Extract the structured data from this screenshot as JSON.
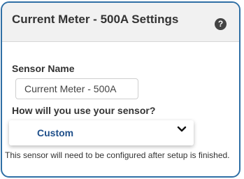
{
  "header": {
    "title": "Current Meter - 500A Settings",
    "help_icon": "question-icon",
    "help_glyph": "?"
  },
  "form": {
    "sensor_name_label": "Sensor Name",
    "sensor_name_value": "Current Meter - 500A",
    "usage_label": "How will you use your sensor?",
    "usage_selected": "Custom",
    "usage_dropdown_icon": "chevron-down-icon",
    "help_text": "This sensor will need to be configured after setup is finished."
  },
  "colors": {
    "border": "#2f6fa5",
    "header_bg": "#f1f1f1",
    "selected_text": "#1f4f8a"
  }
}
